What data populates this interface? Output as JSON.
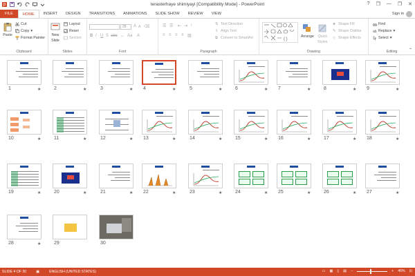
{
  "window": {
    "title": "terasterhaye shimiyayi [Compatibility Mode] - PowerPoint",
    "controls": [
      "?",
      "❐",
      "—",
      "❐",
      "✕"
    ]
  },
  "tabs": [
    {
      "label": "FILE",
      "kind": "file"
    },
    {
      "label": "HOME",
      "kind": "active"
    },
    {
      "label": "INSERT",
      "kind": ""
    },
    {
      "label": "DESIGN",
      "kind": ""
    },
    {
      "label": "TRANSITIONS",
      "kind": ""
    },
    {
      "label": "ANIMATIONS",
      "kind": ""
    },
    {
      "label": "SLIDE SHOW",
      "kind": ""
    },
    {
      "label": "REVIEW",
      "kind": ""
    },
    {
      "label": "VIEW",
      "kind": ""
    }
  ],
  "signin": "Sign in",
  "ribbon": {
    "clipboard": {
      "label": "Clipboard",
      "paste": "Paste",
      "cut": "Cut",
      "copy": "Copy",
      "format_painter": "Format Painter"
    },
    "slides": {
      "label": "Slides",
      "new_slide": "New",
      "new_slide2": "Slide",
      "layout": "Layout",
      "reset": "Reset",
      "section": "Section"
    },
    "font": {
      "label": "Font",
      "size": "28"
    },
    "paragraph": {
      "label": "Paragraph",
      "text_direction": "Text Direction",
      "align_text": "Align Text",
      "smartart": "Convert to SmartArt"
    },
    "drawing": {
      "label": "Drawing",
      "arrange": "Arrange",
      "quick_styles": "Quick",
      "quick_styles2": "Styles",
      "shape_fill": "Shape Fill",
      "shape_outline": "Shape Outline",
      "shape_effects": "Shape Effects"
    },
    "editing": {
      "label": "Editing",
      "find": "Find",
      "replace": "Replace",
      "select": "Select"
    }
  },
  "slides": {
    "selected": 4,
    "numbers": [
      "1",
      "2",
      "3",
      "4",
      "5",
      "6",
      "7",
      "8",
      "9",
      "10",
      "11",
      "12",
      "13",
      "14",
      "15",
      "16",
      "17",
      "18",
      "19",
      "20",
      "21",
      "22",
      "23",
      "24",
      "25",
      "26",
      "27",
      "28",
      "29",
      "30"
    ],
    "star": "★"
  },
  "status": {
    "slide": "SLIDE 4 OF 30",
    "language": "ENGLISH (UNITED STATES)",
    "zoom": "46%",
    "zoom_fraction": 0.46
  },
  "colors": {
    "accent": "#d24726",
    "header": "#1f4e9e"
  }
}
